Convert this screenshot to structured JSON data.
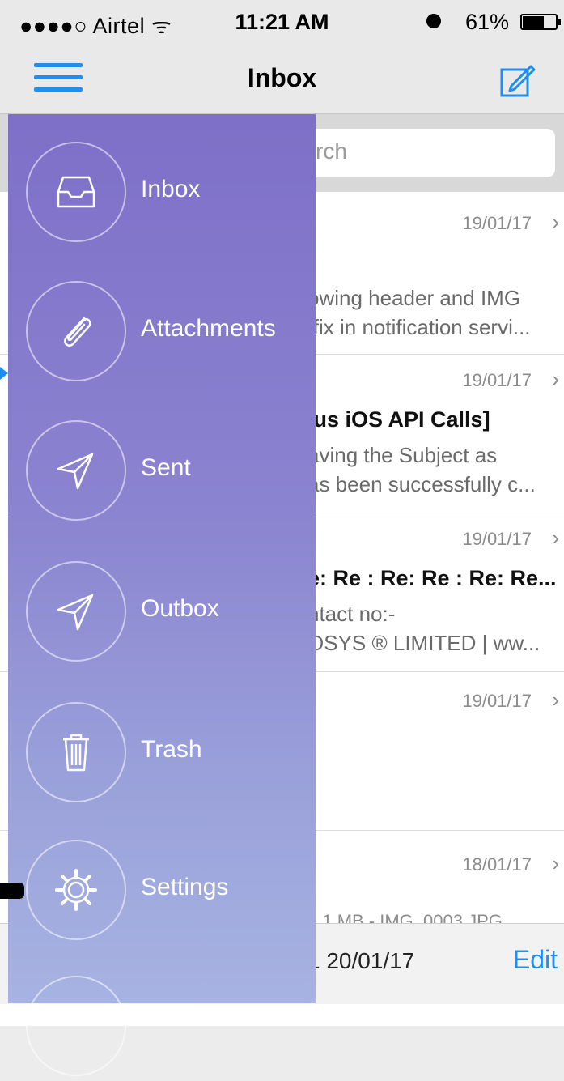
{
  "status_bar": {
    "carrier": "●●●●○ Airtel ᯤ",
    "time": "11:21 AM",
    "battery": "61%"
  },
  "nav": {
    "title": "Inbox",
    "menu_icon": "hamburger-icon",
    "compose_icon": "compose-icon"
  },
  "search": {
    "placeholder_visible": "rch"
  },
  "drawer": {
    "items": [
      {
        "label": "Inbox",
        "icon": "inbox-tray-icon"
      },
      {
        "label": "Attachments",
        "icon": "paperclip-icon"
      },
      {
        "label": "Sent",
        "icon": "paper-plane-icon"
      },
      {
        "label": "Outbox",
        "icon": "paper-plane-icon"
      },
      {
        "label": "Trash",
        "icon": "trash-icon"
      },
      {
        "label": "Settings",
        "icon": "gear-icon"
      }
    ]
  },
  "messages": [
    {
      "date": "19/01/17",
      "subject": "",
      "preview1": "owing header and IMG",
      "preview2": "ffix in notification servi..."
    },
    {
      "date": "19/01/17",
      "subject": "lus iOS API Calls]",
      "preview1": "aving the Subject as",
      "preview2": "as been successfully c..."
    },
    {
      "date": "19/01/17",
      "subject": "e: Re : Re: Re : Re: Re...",
      "preview1": "ntact no:-",
      "preview2": "OSYS ® LIMITED | ww..."
    },
    {
      "date": "19/01/17",
      "subject": "",
      "preview1": "",
      "preview2": ""
    },
    {
      "date": "18/01/17",
      "subject": "",
      "preview1": "",
      "preview2": "1.1 MB - IMG_0003.JPG"
    }
  ],
  "bottom_bar": {
    "updated": "1 20/01/17",
    "edit_label": "Edit"
  },
  "chevron": "›",
  "colors": {
    "accent": "#1e8ff0",
    "drawer_top": "#7e6fc8",
    "drawer_bottom": "#a7b3e2"
  }
}
